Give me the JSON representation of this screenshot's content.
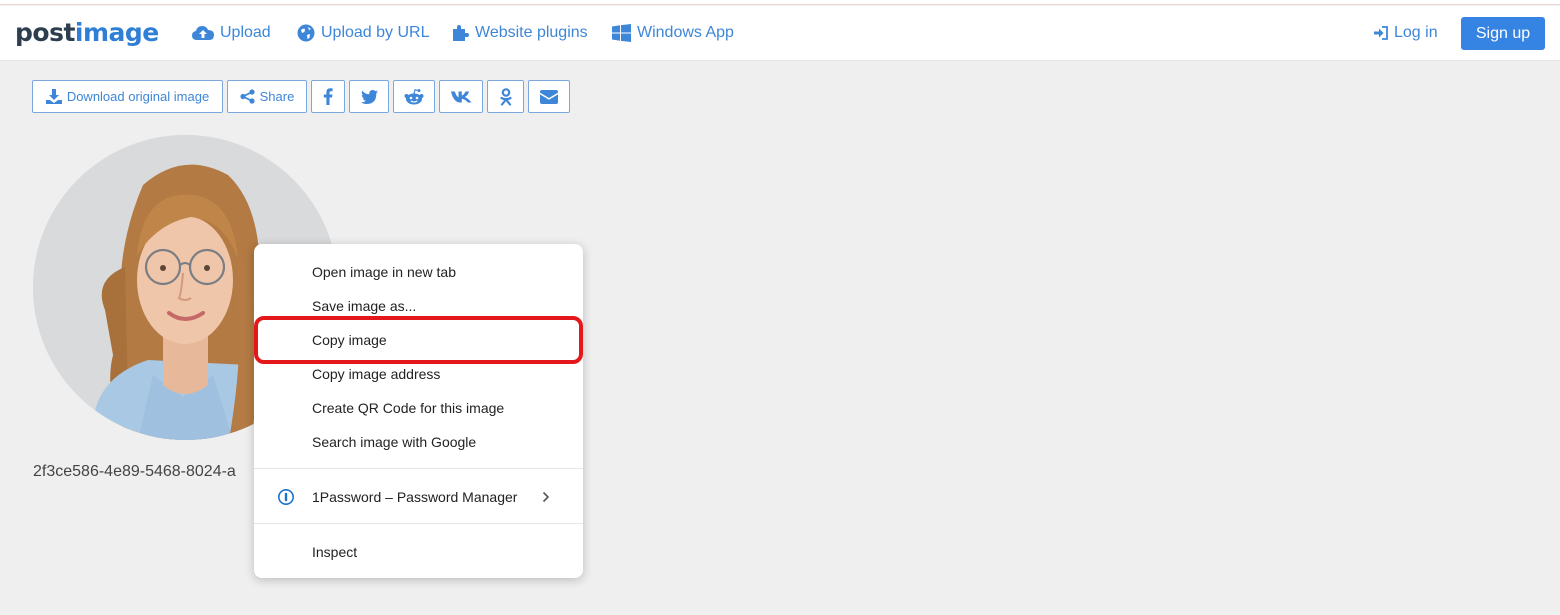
{
  "brand": {
    "logo_main": "post",
    "logo_accent": "image"
  },
  "nav": {
    "upload": "Upload",
    "upload_url": "Upload by URL",
    "plugins": "Website plugins",
    "windows_app": "Windows App",
    "login": "Log in",
    "signup": "Sign up"
  },
  "share_bar": {
    "download": "Download original image",
    "share": "Share"
  },
  "image": {
    "filename": "2f3ce586-4e89-5468-8024-a"
  },
  "context_menu": {
    "items": [
      "Open image in new tab",
      "Save image as...",
      "Copy image",
      "Copy image address",
      "Create QR Code for this image",
      "Search image with Google"
    ],
    "extension": "1Password – Password Manager",
    "inspect": "Inspect",
    "highlighted_item": "Copy image"
  },
  "colors": {
    "accent": "#3d86d8",
    "signup_bg": "#3584e4",
    "highlight": "#e4181a",
    "page_bg": "#efefef"
  }
}
